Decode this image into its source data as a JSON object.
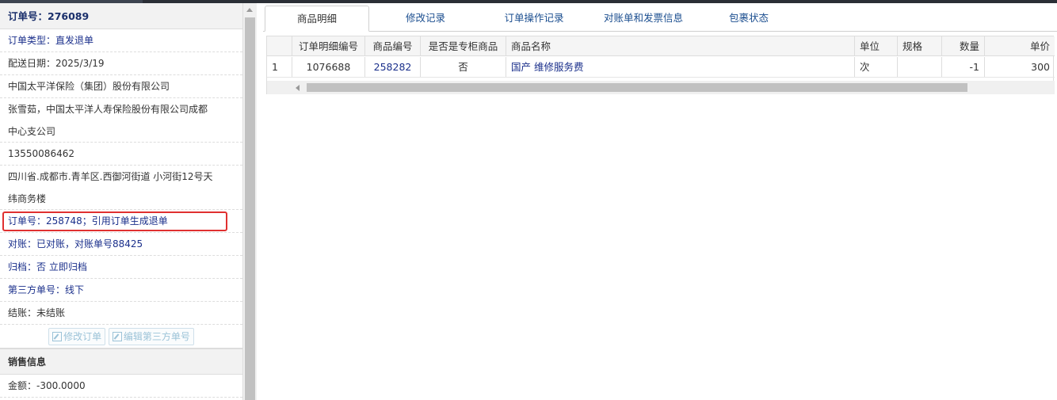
{
  "order": {
    "title": "订单号：276089",
    "type_label": "订单类型：",
    "type_value": "直发退单",
    "delivery_date": "配送日期：2025/3/19",
    "company": "中国太平洋保险（集团）股份有限公司",
    "contact_line1": "张雪茹，中国太平洋人寿保险股份有限公司成都",
    "contact_line2": "中心支公司",
    "phone": "13550086462",
    "address_line1": "四川省.成都市.青羊区.西御河街道 小河街12号天",
    "address_line2": "纬商务楼",
    "ref_order": "订单号：258748；引用订单生成退单",
    "reconcile": "对账：已对账，对账单号88425",
    "archive_label": "归档：",
    "archive_value": "否 立即归档",
    "third_party_label": "第三方单号：",
    "third_party_value": "线下",
    "settlement": "结账：未结账",
    "edit_order_btn": "修改订单",
    "edit_third_btn": "编辑第三方单号",
    "sales_section": "销售信息",
    "amount": "金额：-300.0000"
  },
  "tabs": [
    "商品明细",
    "修改记录",
    "订单操作记录",
    "对账单和发票信息",
    "包裹状态"
  ],
  "table": {
    "headers": [
      "",
      "订单明细编号",
      "商品编号",
      "是否是专柜商品",
      "商品名称",
      "单位",
      "规格",
      "数量",
      "单价"
    ],
    "rows": [
      [
        "1",
        "1076688",
        "258282",
        "否",
        "国产 维修服务费",
        "次",
        "",
        "-1",
        "300"
      ]
    ]
  }
}
